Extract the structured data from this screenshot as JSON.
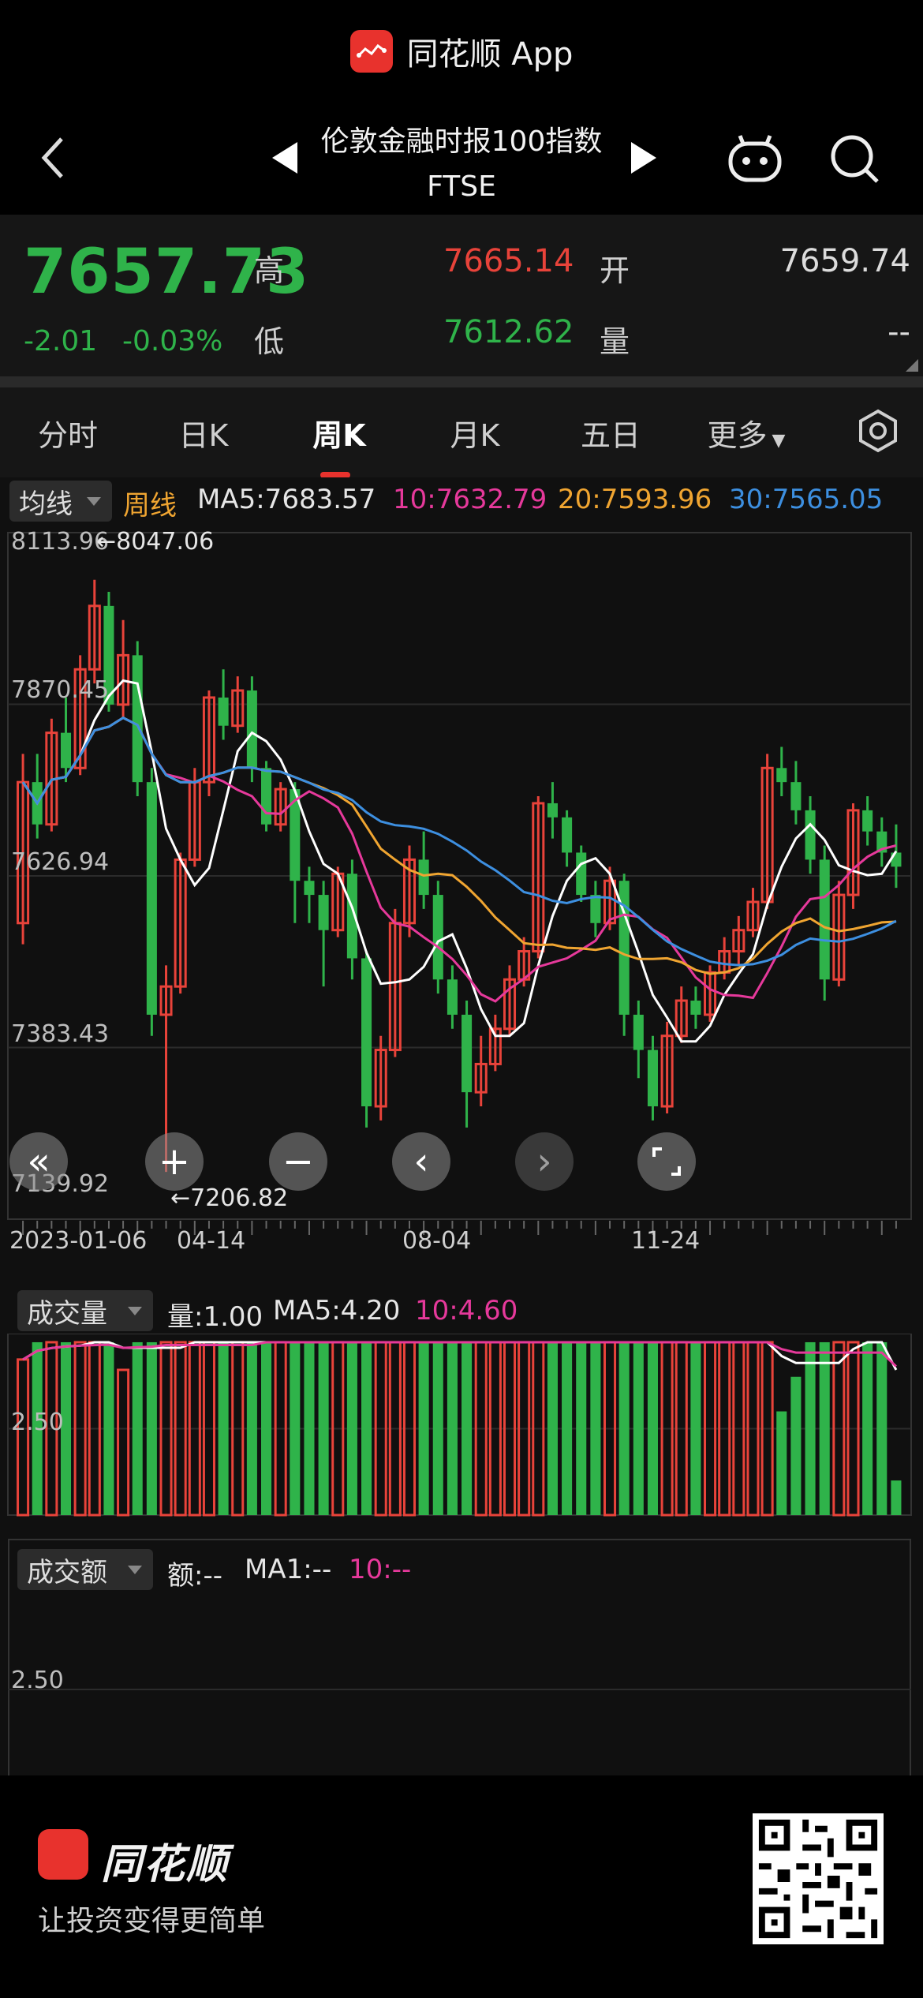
{
  "app": {
    "name": "同花顺 App"
  },
  "nav": {
    "title": "伦敦金融时报100指数",
    "code": "FTSE"
  },
  "quote": {
    "price": "7657.73",
    "change": "-2.01",
    "change_pct": "-0.03%",
    "high_label": "高",
    "high": "7665.14",
    "low_label": "低",
    "low": "7612.62",
    "open_label": "开",
    "open": "7659.74",
    "volume_label": "量",
    "volume": "--"
  },
  "tabs": [
    "分时",
    "日K",
    "周K",
    "月K",
    "五日",
    "更多"
  ],
  "active_tab": "周K",
  "legend": {
    "indicator": "均线",
    "period": "周线",
    "ma5": "MA5:7683.57",
    "ma10": "10:7632.79",
    "ma20": "20:7593.96",
    "ma30": "30:7565.05"
  },
  "colors": {
    "up": "#e8433a",
    "down": "#2fb34a",
    "ma5": "#ffffff",
    "ma10": "#e6399b",
    "ma20": "#f0a531",
    "ma30": "#3d8fe0",
    "brand": "#e8322d"
  },
  "price_axis": [
    "8113.96",
    "7870.45",
    "7626.94",
    "7383.43",
    "7139.92"
  ],
  "markers": {
    "high": "←8047.06",
    "low": "←7206.82"
  },
  "date_axis": [
    "2023-01-06",
    "04-14",
    "08-04",
    "11-24"
  ],
  "volume_panel": {
    "indicator": "成交量",
    "vol": "量:1.00",
    "ma5": "MA5:4.20",
    "ma10": "10:4.60",
    "axis": "2.50"
  },
  "amount_panel": {
    "indicator": "成交额",
    "amt": "额:--",
    "ma1": "MA1:--",
    "ma10": "10:--",
    "axis": "2.50"
  },
  "footer": {
    "brand": "同花顺",
    "slogan": "让投资变得更简单"
  },
  "chart_data": {
    "type": "candlestick",
    "period": "weekly",
    "ylim": [
      7139.92,
      8113.96
    ],
    "high_marker": 8047.06,
    "low_marker": 7206.82,
    "candles": [
      {
        "o": 7560,
        "c": 7760,
        "h": 7800,
        "l": 7530
      },
      {
        "o": 7760,
        "c": 7700,
        "h": 7800,
        "l": 7680
      },
      {
        "o": 7700,
        "c": 7830,
        "h": 7850,
        "l": 7690
      },
      {
        "o": 7830,
        "c": 7780,
        "h": 7880,
        "l": 7760
      },
      {
        "o": 7780,
        "c": 7920,
        "h": 7940,
        "l": 7770
      },
      {
        "o": 7920,
        "c": 8010,
        "h": 8047,
        "l": 7900
      },
      {
        "o": 8010,
        "c": 7870,
        "h": 8030,
        "l": 7860
      },
      {
        "o": 7870,
        "c": 7940,
        "h": 7990,
        "l": 7850
      },
      {
        "o": 7940,
        "c": 7760,
        "h": 7960,
        "l": 7740
      },
      {
        "o": 7760,
        "c": 7430,
        "h": 7780,
        "l": 7400
      },
      {
        "o": 7430,
        "c": 7470,
        "h": 7500,
        "l": 7207
      },
      {
        "o": 7470,
        "c": 7650,
        "h": 7660,
        "l": 7460
      },
      {
        "o": 7650,
        "c": 7760,
        "h": 7780,
        "l": 7640
      },
      {
        "o": 7760,
        "c": 7880,
        "h": 7890,
        "l": 7740
      },
      {
        "o": 7880,
        "c": 7840,
        "h": 7920,
        "l": 7820
      },
      {
        "o": 7840,
        "c": 7890,
        "h": 7910,
        "l": 7830
      },
      {
        "o": 7890,
        "c": 7780,
        "h": 7910,
        "l": 7760
      },
      {
        "o": 7780,
        "c": 7700,
        "h": 7790,
        "l": 7690
      },
      {
        "o": 7700,
        "c": 7750,
        "h": 7760,
        "l": 7690
      },
      {
        "o": 7750,
        "c": 7620,
        "h": 7760,
        "l": 7560
      },
      {
        "o": 7620,
        "c": 7600,
        "h": 7640,
        "l": 7560
      },
      {
        "o": 7600,
        "c": 7550,
        "h": 7620,
        "l": 7470
      },
      {
        "o": 7550,
        "c": 7630,
        "h": 7640,
        "l": 7540
      },
      {
        "o": 7630,
        "c": 7510,
        "h": 7650,
        "l": 7480
      },
      {
        "o": 7510,
        "c": 7300,
        "h": 7520,
        "l": 7270
      },
      {
        "o": 7300,
        "c": 7380,
        "h": 7400,
        "l": 7280
      },
      {
        "o": 7380,
        "c": 7560,
        "h": 7580,
        "l": 7370
      },
      {
        "o": 7560,
        "c": 7650,
        "h": 7670,
        "l": 7540
      },
      {
        "o": 7650,
        "c": 7600,
        "h": 7690,
        "l": 7580
      },
      {
        "o": 7600,
        "c": 7480,
        "h": 7620,
        "l": 7460
      },
      {
        "o": 7480,
        "c": 7430,
        "h": 7500,
        "l": 7410
      },
      {
        "o": 7430,
        "c": 7320,
        "h": 7450,
        "l": 7270
      },
      {
        "o": 7320,
        "c": 7360,
        "h": 7400,
        "l": 7300
      },
      {
        "o": 7360,
        "c": 7410,
        "h": 7430,
        "l": 7350
      },
      {
        "o": 7410,
        "c": 7480,
        "h": 7500,
        "l": 7400
      },
      {
        "o": 7480,
        "c": 7520,
        "h": 7540,
        "l": 7470
      },
      {
        "o": 7520,
        "c": 7730,
        "h": 7740,
        "l": 7510
      },
      {
        "o": 7730,
        "c": 7710,
        "h": 7760,
        "l": 7680
      },
      {
        "o": 7710,
        "c": 7660,
        "h": 7720,
        "l": 7640
      },
      {
        "o": 7660,
        "c": 7600,
        "h": 7670,
        "l": 7590
      },
      {
        "o": 7600,
        "c": 7560,
        "h": 7620,
        "l": 7540
      },
      {
        "o": 7560,
        "c": 7620,
        "h": 7640,
        "l": 7550
      },
      {
        "o": 7620,
        "c": 7430,
        "h": 7630,
        "l": 7400
      },
      {
        "o": 7430,
        "c": 7380,
        "h": 7450,
        "l": 7340
      },
      {
        "o": 7380,
        "c": 7300,
        "h": 7400,
        "l": 7280
      },
      {
        "o": 7300,
        "c": 7400,
        "h": 7420,
        "l": 7290
      },
      {
        "o": 7400,
        "c": 7450,
        "h": 7470,
        "l": 7390
      },
      {
        "o": 7450,
        "c": 7430,
        "h": 7470,
        "l": 7410
      },
      {
        "o": 7430,
        "c": 7490,
        "h": 7500,
        "l": 7420
      },
      {
        "o": 7490,
        "c": 7520,
        "h": 7540,
        "l": 7480
      },
      {
        "o": 7520,
        "c": 7550,
        "h": 7570,
        "l": 7500
      },
      {
        "o": 7550,
        "c": 7590,
        "h": 7610,
        "l": 7540
      },
      {
        "o": 7590,
        "c": 7780,
        "h": 7800,
        "l": 7580
      },
      {
        "o": 7780,
        "c": 7760,
        "h": 7810,
        "l": 7740
      },
      {
        "o": 7760,
        "c": 7720,
        "h": 7790,
        "l": 7700
      },
      {
        "o": 7720,
        "c": 7650,
        "h": 7740,
        "l": 7630
      },
      {
        "o": 7650,
        "c": 7480,
        "h": 7670,
        "l": 7450
      },
      {
        "o": 7480,
        "c": 7600,
        "h": 7620,
        "l": 7470
      },
      {
        "o": 7600,
        "c": 7720,
        "h": 7730,
        "l": 7580
      },
      {
        "o": 7720,
        "c": 7690,
        "h": 7740,
        "l": 7670
      },
      {
        "o": 7690,
        "c": 7660,
        "h": 7710,
        "l": 7640
      },
      {
        "o": 7660,
        "c": 7640,
        "h": 7700,
        "l": 7610
      }
    ],
    "volume": [
      4.5,
      5.0,
      5.0,
      5.0,
      5.0,
      5.0,
      5.0,
      4.2,
      5.0,
      5.0,
      5.0,
      5.0,
      5.0,
      5.0,
      5.0,
      5.0,
      5.0,
      5.0,
      5.0,
      5.0,
      5.0,
      5.0,
      5.0,
      5.0,
      5.0,
      5.0,
      5.0,
      5.0,
      5.0,
      5.0,
      5.0,
      5.0,
      5.0,
      5.0,
      5.0,
      5.0,
      5.0,
      5.0,
      5.0,
      5.0,
      5.0,
      5.0,
      5.0,
      5.0,
      5.0,
      5.0,
      5.0,
      5.0,
      5.0,
      5.0,
      5.0,
      5.0,
      5.0,
      3.0,
      4.0,
      5.0,
      5.0,
      5.0,
      5.0,
      5.0,
      5.0,
      1.0
    ],
    "volume_max": 5.0
  }
}
